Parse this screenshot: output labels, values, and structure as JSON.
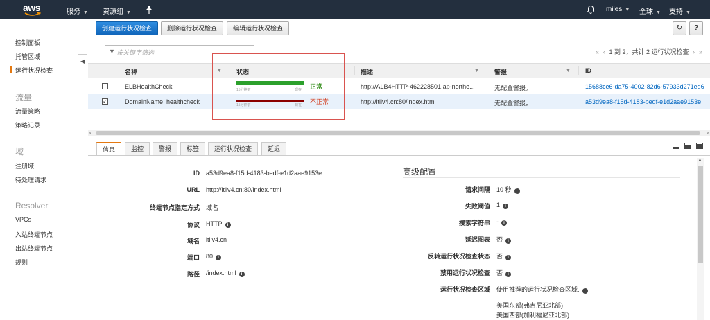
{
  "nav": {
    "logo": "aws",
    "services": "服务",
    "resource_groups": "资源组",
    "user": "miles",
    "region": "全球",
    "support": "支持"
  },
  "sidebar": {
    "items": [
      {
        "label": "控制面板"
      },
      {
        "label": "托管区域"
      },
      {
        "label": "运行状况检查",
        "active": true
      }
    ],
    "traffic_heading": "流量",
    "traffic_items": [
      {
        "label": "流量策略"
      },
      {
        "label": "策略记录"
      }
    ],
    "domain_heading": "域",
    "domain_items": [
      {
        "label": "注册域"
      },
      {
        "label": "待处理请求"
      }
    ],
    "resolver_heading": "Resolver",
    "resolver_items": [
      {
        "label": "VPCs"
      },
      {
        "label": "入站终端节点"
      },
      {
        "label": "出站终端节点"
      },
      {
        "label": "规则"
      }
    ]
  },
  "toolbar": {
    "create": "创建运行状况检查",
    "delete": "删除运行状况检查",
    "edit": "编辑运行状况检查"
  },
  "filter": {
    "placeholder": "按关键字筛选"
  },
  "pager": {
    "text": "1 到 2，共计 2 运行状况检查"
  },
  "table": {
    "headers": [
      "名称",
      "状态",
      "描述",
      "警报",
      "ID"
    ],
    "bar_left_label": "15分钟前",
    "bar_right_label": "现在",
    "rows": [
      {
        "name": "ELBHealthCheck",
        "status": "正常",
        "status_color": "#1d8102",
        "bar_color": "#2ca02c",
        "description": "http://ALB4HTTP-462228501.ap-northe...",
        "alarm": "无配置警报。",
        "id": "15688ce6-da75-4002-82d6-57933d271ed6",
        "selected": false
      },
      {
        "name": "DomainName_healthcheck",
        "status": "不正常",
        "status_color": "#d13212",
        "bar_color": "#8b0000",
        "description": "http://itilv4.cn:80/index.html",
        "alarm": "无配置警报。",
        "id": "a53d9ea8-f15d-4183-bedf-e1d2aae9153e",
        "selected": true
      }
    ]
  },
  "tabs": [
    "信息",
    "监控",
    "警报",
    "标签",
    "运行状况检查",
    "延迟"
  ],
  "details": {
    "id_label": "ID",
    "id_value": "a53d9ea8-f15d-4183-bedf-e1d2aae9153e",
    "url_label": "URL",
    "url_value": "http://itilv4.cn:80/index.html",
    "endpoint_label": "终端节点指定方式",
    "endpoint_value": "域名",
    "protocol_label": "协议",
    "protocol_value": "HTTP",
    "domain_label": "域名",
    "domain_value": "itilv4.cn",
    "port_label": "端口",
    "port_value": "80",
    "path_label": "路径",
    "path_value": "/index.html"
  },
  "advanced": {
    "heading": "高级配置",
    "interval_label": "请求间隔",
    "interval_value": "10 秒",
    "threshold_label": "失败阈值",
    "threshold_value": "1",
    "search_label": "搜索字符串",
    "search_value": "-",
    "latency_label": "延迟图表",
    "latency_value": "否",
    "invert_label": "反转运行状况检查状态",
    "invert_value": "否",
    "disabled_label": "禁用运行状况检查",
    "disabled_value": "否",
    "regions_label": "运行状况检查区域",
    "regions_value": "使用推荐的运行状况检查区域.",
    "regions": [
      "美国东部(弗吉尼亚北部)",
      "美国西部(加利福尼亚北部)"
    ]
  }
}
